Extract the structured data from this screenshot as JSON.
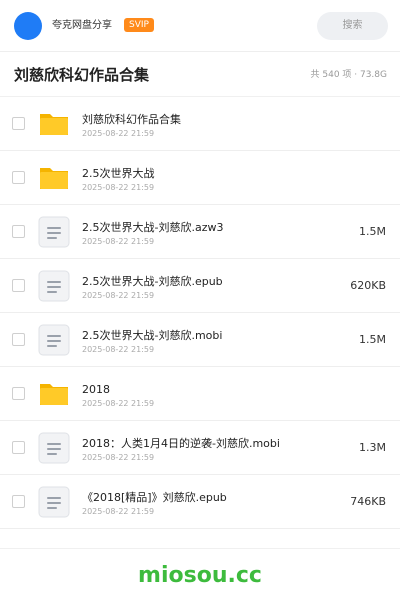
{
  "header": {
    "brand_label": "夸克网盘分享",
    "svip_badge": "SVIP",
    "search_label": "搜索"
  },
  "page": {
    "title": "刘慈欣科幻作品合集",
    "summary": "共 540 项 · 73.8G"
  },
  "files": [
    {
      "type": "folder",
      "icon": "folder-icon",
      "name": "刘慈欣科幻作品合集",
      "date": "2025-08-22 21:59",
      "size": ""
    },
    {
      "type": "folder",
      "icon": "folder-icon",
      "name": "2.5次世界大战",
      "date": "2025-08-22 21:59",
      "size": ""
    },
    {
      "type": "file",
      "icon": "document-icon",
      "name": "2.5次世界大战-刘慈欣.azw3",
      "date": "2025-08-22 21:59",
      "size": "1.5M"
    },
    {
      "type": "file",
      "icon": "document-icon",
      "name": "2.5次世界大战-刘慈欣.epub",
      "date": "2025-08-22 21:59",
      "size": "620KB"
    },
    {
      "type": "file",
      "icon": "document-icon",
      "name": "2.5次世界大战-刘慈欣.mobi",
      "date": "2025-08-22 21:59",
      "size": "1.5M"
    },
    {
      "type": "folder",
      "icon": "folder-icon",
      "name": "2018",
      "date": "2025-08-22 21:59",
      "size": ""
    },
    {
      "type": "file",
      "icon": "document-icon",
      "name": "2018：人类1月4日的逆袭-刘慈欣.mobi",
      "date": "2025-08-22 21:59",
      "size": "1.3M"
    },
    {
      "type": "file",
      "icon": "document-icon",
      "name": "《2018[精品]》刘慈欣.epub",
      "date": "2025-08-22 21:59",
      "size": "746KB"
    }
  ],
  "footer": {
    "watermark": "miosou.cc"
  },
  "colors": {
    "avatar": "#1f7cf6",
    "svip": "#ff8a1a",
    "folder_back": "#f5b400",
    "folder_front": "#ffca28",
    "doc_bg": "#f2f3f5",
    "doc_lines": "#9aa1ab",
    "watermark": "#3dbb3d"
  }
}
